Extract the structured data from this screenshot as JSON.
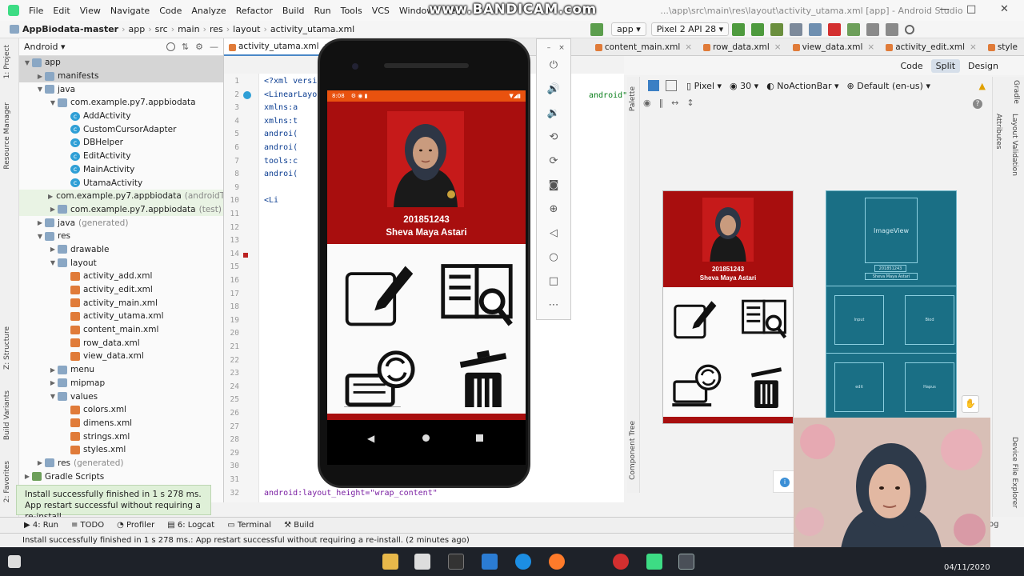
{
  "menubar": {
    "items": [
      "File",
      "Edit",
      "View",
      "Navigate",
      "Code",
      "Analyze",
      "Refactor",
      "Build",
      "Run",
      "Tools",
      "VCS",
      "Window",
      "Help"
    ],
    "window_title": "...\\app\\src\\main\\res\\layout\\activity_utama.xml [app] - Android Studio",
    "watermark": "www.BANDICAM.com"
  },
  "breadcrumb": [
    "AppBiodata-master",
    "app",
    "src",
    "main",
    "res",
    "layout",
    "activity_utama.xml"
  ],
  "run_config": {
    "module": "app",
    "device": "Pixel 2 API 28"
  },
  "project_panel": {
    "view_mode": "Android",
    "tree": [
      {
        "label": "app",
        "depth": 0,
        "type": "folder",
        "expanded": true,
        "selected": true
      },
      {
        "label": "manifests",
        "depth": 1,
        "type": "folder",
        "expanded": false,
        "selected": true
      },
      {
        "label": "java",
        "depth": 1,
        "type": "folder",
        "expanded": true
      },
      {
        "label": "com.example.py7.appbiodata",
        "depth": 2,
        "type": "folder",
        "expanded": true
      },
      {
        "label": "AddActivity",
        "depth": 3,
        "type": "class"
      },
      {
        "label": "CustomCursorAdapter",
        "depth": 3,
        "type": "class"
      },
      {
        "label": "DBHelper",
        "depth": 3,
        "type": "class"
      },
      {
        "label": "EditActivity",
        "depth": 3,
        "type": "class"
      },
      {
        "label": "MainActivity",
        "depth": 3,
        "type": "class"
      },
      {
        "label": "UtamaActivity",
        "depth": 3,
        "type": "class"
      },
      {
        "label": "com.example.py7.appbiodata",
        "suffix": "(androidTest)",
        "depth": 2,
        "type": "folder",
        "expanded": false,
        "green": true
      },
      {
        "label": "com.example.py7.appbiodata",
        "suffix": "(test)",
        "depth": 2,
        "type": "folder",
        "expanded": false,
        "green": true
      },
      {
        "label": "java",
        "suffix": "(generated)",
        "depth": 1,
        "type": "folder",
        "expanded": false
      },
      {
        "label": "res",
        "depth": 1,
        "type": "folder",
        "expanded": true
      },
      {
        "label": "drawable",
        "depth": 2,
        "type": "folder",
        "expanded": false
      },
      {
        "label": "layout",
        "depth": 2,
        "type": "folder",
        "expanded": true
      },
      {
        "label": "activity_add.xml",
        "depth": 3,
        "type": "xml"
      },
      {
        "label": "activity_edit.xml",
        "depth": 3,
        "type": "xml"
      },
      {
        "label": "activity_main.xml",
        "depth": 3,
        "type": "xml"
      },
      {
        "label": "activity_utama.xml",
        "depth": 3,
        "type": "xml"
      },
      {
        "label": "content_main.xml",
        "depth": 3,
        "type": "xml"
      },
      {
        "label": "row_data.xml",
        "depth": 3,
        "type": "xml"
      },
      {
        "label": "view_data.xml",
        "depth": 3,
        "type": "xml"
      },
      {
        "label": "menu",
        "depth": 2,
        "type": "folder",
        "expanded": false
      },
      {
        "label": "mipmap",
        "depth": 2,
        "type": "folder",
        "expanded": false
      },
      {
        "label": "values",
        "depth": 2,
        "type": "folder",
        "expanded": true
      },
      {
        "label": "colors.xml",
        "depth": 3,
        "type": "xml"
      },
      {
        "label": "dimens.xml",
        "depth": 3,
        "type": "xml"
      },
      {
        "label": "strings.xml",
        "depth": 3,
        "type": "xml"
      },
      {
        "label": "styles.xml",
        "depth": 3,
        "type": "xml"
      },
      {
        "label": "res",
        "suffix": "(generated)",
        "depth": 1,
        "type": "folder",
        "expanded": false
      },
      {
        "label": "Gradle Scripts",
        "depth": 0,
        "type": "gradle",
        "expanded": false
      }
    ]
  },
  "side_tabs": [
    "1: Project",
    "Resource Manager",
    "Z: Structure",
    "Build Variants",
    "2: Favorites"
  ],
  "editor_tabs": [
    {
      "label": "activity_utama.xml",
      "active": true
    },
    {
      "label": "content_main.xml"
    },
    {
      "label": "row_data.xml"
    },
    {
      "label": "view_data.xml"
    },
    {
      "label": "activity_edit.xml"
    },
    {
      "label": "style"
    }
  ],
  "editor_modes": [
    "Code",
    "Split",
    "Design"
  ],
  "code_lines": [
    {
      "n": "1",
      "text": "<?xml versi"
    },
    {
      "n": "2",
      "text": "<LinearLayo"
    },
    {
      "n": "3",
      "text": "    xmlns:a"
    },
    {
      "n": "4",
      "text": "    xmlns:t"
    },
    {
      "n": "5",
      "text": "    androi("
    },
    {
      "n": "6",
      "text": "    androi("
    },
    {
      "n": "7",
      "text": "    tools:c"
    },
    {
      "n": "8",
      "text": "    androi("
    },
    {
      "n": "9",
      "text": ""
    },
    {
      "n": "10",
      "text": "      <Li"
    },
    {
      "n": "11",
      "text": ""
    },
    {
      "n": "12",
      "text": ""
    },
    {
      "n": "13",
      "text": ""
    },
    {
      "n": "14",
      "text": ""
    },
    {
      "n": "15",
      "text": ""
    },
    {
      "n": "16",
      "text": ""
    },
    {
      "n": "17",
      "text": ""
    },
    {
      "n": "18",
      "text": ""
    },
    {
      "n": "19",
      "text": ""
    },
    {
      "n": "20",
      "text": ""
    },
    {
      "n": "21",
      "text": ""
    },
    {
      "n": "22",
      "text": ""
    },
    {
      "n": "23",
      "text": ""
    },
    {
      "n": "24",
      "text": ""
    },
    {
      "n": "25",
      "text": ""
    },
    {
      "n": "26",
      "text": ""
    },
    {
      "n": "27",
      "text": ""
    },
    {
      "n": "28",
      "text": ""
    },
    {
      "n": "29",
      "text": ""
    },
    {
      "n": "30",
      "text": ""
    },
    {
      "n": "31",
      "text": ""
    },
    {
      "n": "32",
      "text": "        android:layout_height=\"wrap_content\""
    }
  ],
  "code_tail_fragment": "android\"",
  "design_toolbar": {
    "device": "Pixel",
    "api": "30",
    "theme": "NoActionBar",
    "locale": "Default (en-us)"
  },
  "app": {
    "status_time": "8:08",
    "nim": "201851243",
    "name": "Sheva Maya Astari",
    "menu": [
      "edit-icon",
      "biodata-icon",
      "update-icon",
      "delete-icon"
    ]
  },
  "blueprint": {
    "image_label": "ImageView",
    "text1": "201851243",
    "text2": "Sheva Maya Astari",
    "cells": [
      "Input",
      "Biod",
      "edit",
      "Hapus"
    ]
  },
  "right_tabs": [
    "Gradle",
    "Attributes",
    "Layout Validation",
    "Device File Explorer"
  ],
  "palette_label": "Palette",
  "component_tree_label": "Component Tree",
  "toast": {
    "line1": "Install successfully finished in 1 s 278 ms.",
    "line2": "App restart successful without requiring a re-install."
  },
  "bottom_tabs": [
    "4: Run",
    "TODO",
    "Profiler",
    "6: Logcat",
    "Terminal",
    "Build"
  ],
  "status_text": "Install successfully finished in 1 s 278 ms.: App restart successful without requiring a re-install. (2 minutes ago)",
  "log_label": "og",
  "taskbar": {
    "date": "04/11/2020"
  },
  "colors": {
    "app_red": "#a80e0e",
    "status_orange": "#e9520f",
    "blueprint": "#1a6f85",
    "ide_accent": "#4a88c7"
  }
}
